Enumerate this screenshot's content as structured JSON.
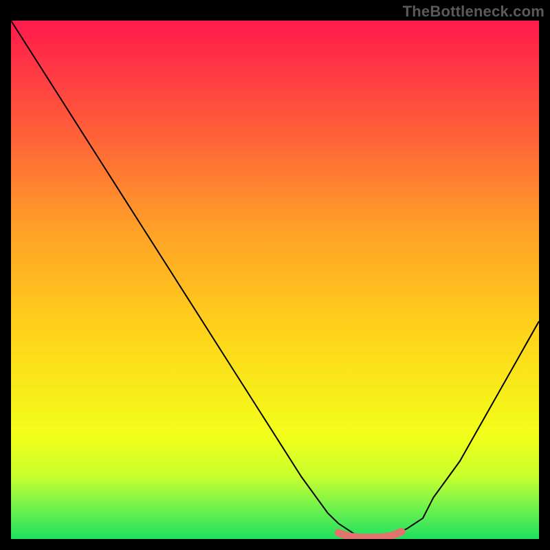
{
  "watermark": "TheBottleneck.com",
  "chart_data": {
    "type": "line",
    "title": "",
    "xlabel": "",
    "ylabel": "",
    "xlim": [
      0,
      100
    ],
    "ylim": [
      0,
      100
    ],
    "grid": false,
    "series": [
      {
        "name": "bottleneck-curve",
        "color": "#000000",
        "x": [
          0,
          5,
          10,
          15,
          20,
          25,
          30,
          35,
          40,
          45,
          50,
          55,
          60,
          62,
          65,
          68,
          70,
          73,
          75,
          78,
          80,
          85,
          90,
          95,
          100
        ],
        "values": [
          100,
          92,
          84,
          76,
          68,
          60,
          52,
          44,
          36,
          28,
          20,
          12,
          5,
          3,
          1,
          0.5,
          0.5,
          1,
          2,
          4,
          8,
          15,
          24,
          33,
          42
        ]
      },
      {
        "name": "optimal-band",
        "color": "#e0736e",
        "x": [
          62,
          64,
          66,
          68,
          70,
          72,
          74
        ],
        "values": [
          1.2,
          0.5,
          0.3,
          0.3,
          0.3,
          0.6,
          1.4
        ]
      }
    ],
    "gradient_stops": [
      {
        "offset": 0.0,
        "color": "#ff1a4d"
      },
      {
        "offset": 0.2,
        "color": "#ff5a3a"
      },
      {
        "offset": 0.4,
        "color": "#ffa028"
      },
      {
        "offset": 0.6,
        "color": "#ffd31a"
      },
      {
        "offset": 0.8,
        "color": "#f2ff1a"
      },
      {
        "offset": 0.88,
        "color": "#c8ff2e"
      },
      {
        "offset": 0.94,
        "color": "#70f24d"
      },
      {
        "offset": 1.0,
        "color": "#1fe060"
      }
    ]
  }
}
